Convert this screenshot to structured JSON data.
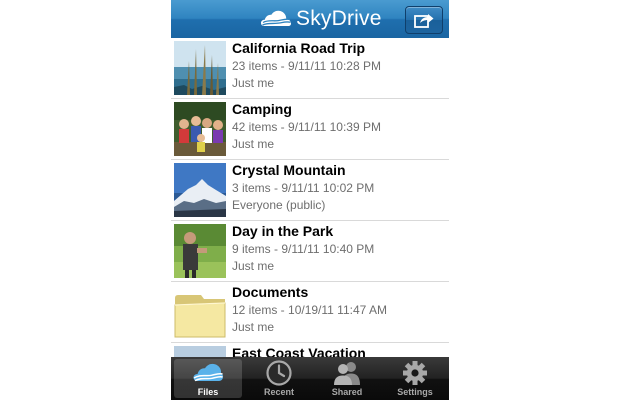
{
  "header": {
    "app_name": "SkyDrive",
    "share_icon": "share-out-icon",
    "colors": {
      "bar": "#2f84c0",
      "bar_dark": "#1a65a2"
    }
  },
  "folders": [
    {
      "title": "California Road Trip",
      "meta": "23 items - 9/11/11 10:28 PM",
      "sharing": "Just me",
      "thumb": "coastline-photo"
    },
    {
      "title": "Camping",
      "meta": "42 items - 9/11/11 10:39 PM",
      "sharing": "Just me",
      "thumb": "group-photo"
    },
    {
      "title": "Crystal Mountain",
      "meta": "3 items - 9/11/11 10:02 PM",
      "sharing": "Everyone (public)",
      "thumb": "mountain-photo"
    },
    {
      "title": "Day in the Park",
      "meta": "9 items - 9/11/11 10:40 PM",
      "sharing": "Just me",
      "thumb": "park-photo"
    },
    {
      "title": "Documents",
      "meta": "12 items - 10/19/11 11:47 AM",
      "sharing": "Just me",
      "thumb": "folder-icon"
    },
    {
      "title": "East Coast Vacation",
      "meta": "",
      "sharing": "",
      "thumb": "vacation-photo"
    }
  ],
  "tabs": [
    {
      "label": "Files",
      "icon": "cloud-icon",
      "active": true
    },
    {
      "label": "Recent",
      "icon": "clock-icon",
      "active": false
    },
    {
      "label": "Shared",
      "icon": "people-icon",
      "active": false
    },
    {
      "label": "Settings",
      "icon": "gear-icon",
      "active": false
    }
  ]
}
